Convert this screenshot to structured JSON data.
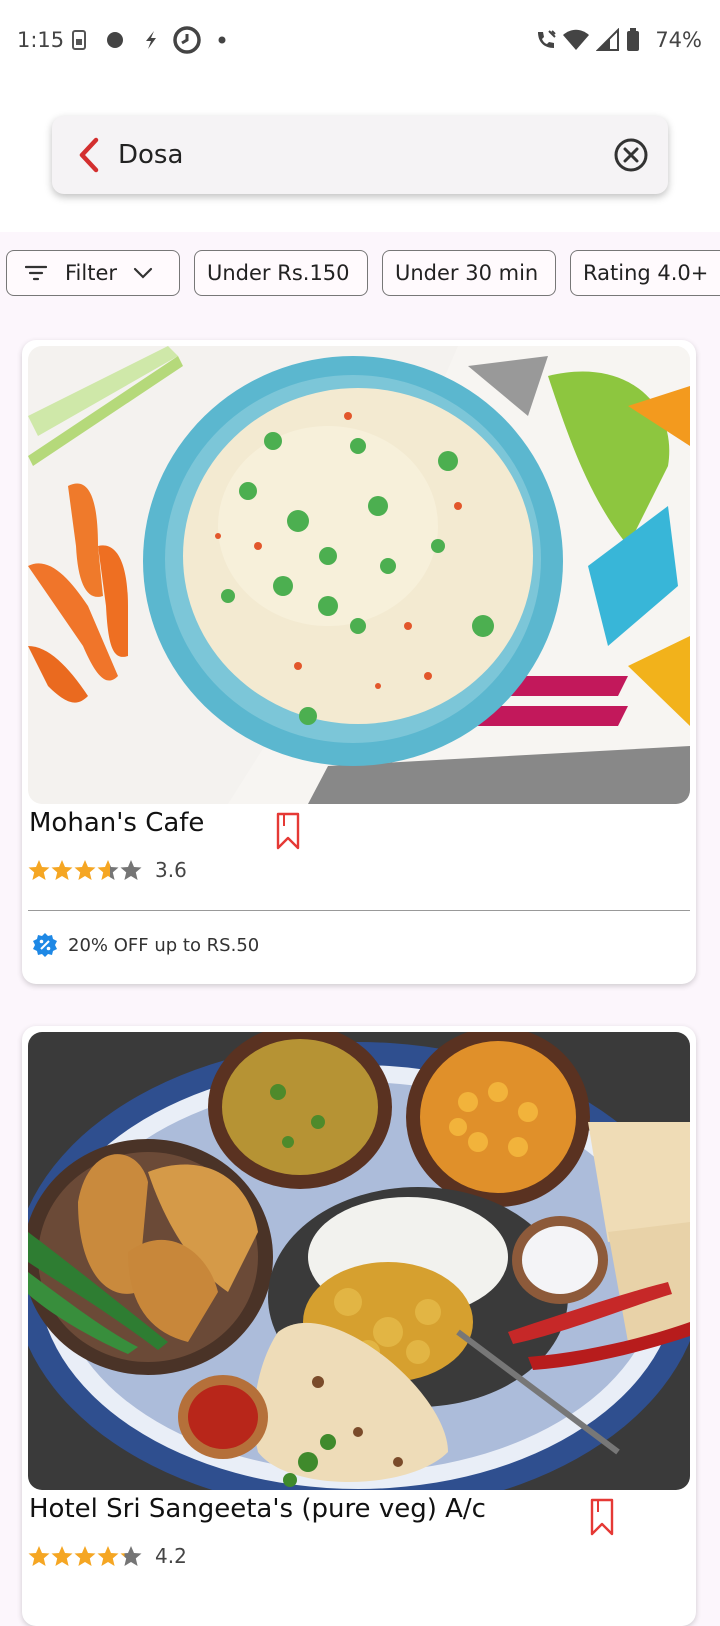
{
  "status_bar": {
    "time": "1:15",
    "battery": "74%",
    "icons": [
      "sim-card-icon",
      "dot-icon",
      "bolt-icon",
      "clock-app-icon",
      "small-dot-icon",
      "vibrate-call-icon",
      "wifi-icon",
      "signal-icon",
      "battery-icon"
    ]
  },
  "search": {
    "query": "Dosa",
    "back_icon": "chevron-left-icon",
    "clear_icon": "clear-circle-icon",
    "accent": "#d32f2f"
  },
  "filters": [
    {
      "label": "Filter",
      "has_dropdown": true
    },
    {
      "label": "Under Rs.150"
    },
    {
      "label": "Under 30 min"
    },
    {
      "label": "Rating 4.0+"
    }
  ],
  "restaurants": [
    {
      "name": "Mohan's Cafe",
      "rating": "3.6",
      "rating_stars": 3.6,
      "offer": "20% OFF up to RS.50",
      "image": "fried rice bowl"
    },
    {
      "name": "Hotel Sri Sangeeta's (pure veg) A/c",
      "rating": "4.2",
      "rating_stars": 4.2,
      "image": "indian thali platter"
    }
  ],
  "colors": {
    "star": "#f5a623",
    "star_empty": "#757575",
    "bookmark": "#e53935",
    "offer_badge": "#1e88e5"
  }
}
